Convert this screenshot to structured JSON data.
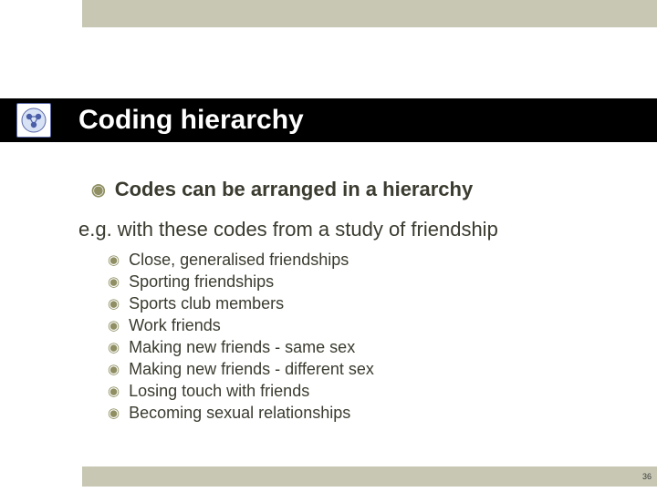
{
  "title": "Coding hierarchy",
  "icon": "network-icon",
  "main_bullet": "Codes can be arranged in a hierarchy",
  "subtitle": "e.g. with these codes from a study of friendship",
  "items": [
    "Close, generalised friendships",
    "Sporting friendships",
    "Sports club members",
    "Work friends",
    "Making new friends - same sex",
    "Making new friends - different sex",
    "Losing touch with friends",
    "Becoming sexual relationships"
  ],
  "page_number": "36",
  "colors": {
    "band": "#c7c7b4",
    "title_bg": "#000000",
    "bullet": "#8f8f63"
  }
}
